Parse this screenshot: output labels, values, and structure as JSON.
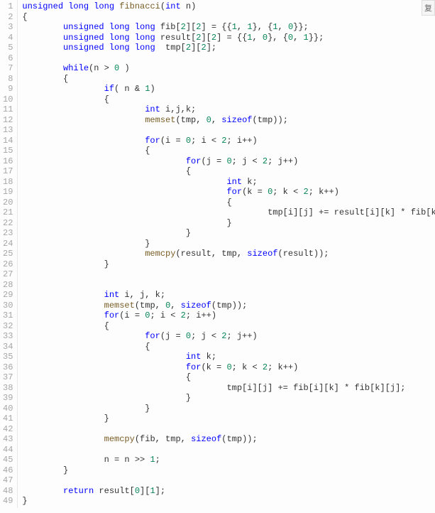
{
  "copy_label": "复",
  "lines": [
    {
      "n": 1,
      "tokens": [
        [
          "kw",
          "unsigned"
        ],
        [
          "pl",
          " "
        ],
        [
          "kw",
          "long"
        ],
        [
          "pl",
          " "
        ],
        [
          "kw",
          "long"
        ],
        [
          "pl",
          " "
        ],
        [
          "fn",
          "fibnacci"
        ],
        [
          "pl",
          "("
        ],
        [
          "kw",
          "int"
        ],
        [
          "pl",
          " n)"
        ]
      ]
    },
    {
      "n": 2,
      "tokens": [
        [
          "pl",
          "{"
        ]
      ]
    },
    {
      "n": 3,
      "tokens": [
        [
          "pl",
          "        "
        ],
        [
          "kw",
          "unsigned"
        ],
        [
          "pl",
          " "
        ],
        [
          "kw",
          "long"
        ],
        [
          "pl",
          " "
        ],
        [
          "kw",
          "long"
        ],
        [
          "pl",
          " fib["
        ],
        [
          "num",
          "2"
        ],
        [
          "pl",
          "]["
        ],
        [
          "num",
          "2"
        ],
        [
          "pl",
          "] = {{"
        ],
        [
          "num",
          "1"
        ],
        [
          "pl",
          ", "
        ],
        [
          "num",
          "1"
        ],
        [
          "pl",
          "}, {"
        ],
        [
          "num",
          "1"
        ],
        [
          "pl",
          ", "
        ],
        [
          "num",
          "0"
        ],
        [
          "pl",
          "}};"
        ]
      ]
    },
    {
      "n": 4,
      "tokens": [
        [
          "pl",
          "        "
        ],
        [
          "kw",
          "unsigned"
        ],
        [
          "pl",
          " "
        ],
        [
          "kw",
          "long"
        ],
        [
          "pl",
          " "
        ],
        [
          "kw",
          "long"
        ],
        [
          "pl",
          " result["
        ],
        [
          "num",
          "2"
        ],
        [
          "pl",
          "]["
        ],
        [
          "num",
          "2"
        ],
        [
          "pl",
          "] = {{"
        ],
        [
          "num",
          "1"
        ],
        [
          "pl",
          ", "
        ],
        [
          "num",
          "0"
        ],
        [
          "pl",
          "}, {"
        ],
        [
          "num",
          "0"
        ],
        [
          "pl",
          ", "
        ],
        [
          "num",
          "1"
        ],
        [
          "pl",
          "}};"
        ]
      ]
    },
    {
      "n": 5,
      "tokens": [
        [
          "pl",
          "        "
        ],
        [
          "kw",
          "unsigned"
        ],
        [
          "pl",
          " "
        ],
        [
          "kw",
          "long"
        ],
        [
          "pl",
          " "
        ],
        [
          "kw",
          "long"
        ],
        [
          "pl",
          "  tmp["
        ],
        [
          "num",
          "2"
        ],
        [
          "pl",
          "]["
        ],
        [
          "num",
          "2"
        ],
        [
          "pl",
          "];"
        ]
      ]
    },
    {
      "n": 6,
      "tokens": [
        [
          "pl",
          ""
        ]
      ]
    },
    {
      "n": 7,
      "tokens": [
        [
          "pl",
          "        "
        ],
        [
          "kw",
          "while"
        ],
        [
          "pl",
          "(n > "
        ],
        [
          "num",
          "0"
        ],
        [
          "pl",
          " )"
        ]
      ]
    },
    {
      "n": 8,
      "tokens": [
        [
          "pl",
          "        {"
        ]
      ]
    },
    {
      "n": 9,
      "tokens": [
        [
          "pl",
          "                "
        ],
        [
          "kw",
          "if"
        ],
        [
          "pl",
          "( n & "
        ],
        [
          "num",
          "1"
        ],
        [
          "pl",
          ")"
        ]
      ]
    },
    {
      "n": 10,
      "tokens": [
        [
          "pl",
          "                {"
        ]
      ]
    },
    {
      "n": 11,
      "tokens": [
        [
          "pl",
          "                        "
        ],
        [
          "kw",
          "int"
        ],
        [
          "pl",
          " i,j,k;"
        ]
      ]
    },
    {
      "n": 12,
      "tokens": [
        [
          "pl",
          "                        "
        ],
        [
          "fn",
          "memset"
        ],
        [
          "pl",
          "(tmp, "
        ],
        [
          "num",
          "0"
        ],
        [
          "pl",
          ", "
        ],
        [
          "kw",
          "sizeof"
        ],
        [
          "pl",
          "(tmp));"
        ]
      ]
    },
    {
      "n": 13,
      "tokens": [
        [
          "pl",
          ""
        ]
      ]
    },
    {
      "n": 14,
      "tokens": [
        [
          "pl",
          "                        "
        ],
        [
          "kw",
          "for"
        ],
        [
          "pl",
          "(i = "
        ],
        [
          "num",
          "0"
        ],
        [
          "pl",
          "; i < "
        ],
        [
          "num",
          "2"
        ],
        [
          "pl",
          "; i++)"
        ]
      ]
    },
    {
      "n": 15,
      "tokens": [
        [
          "pl",
          "                        {"
        ]
      ]
    },
    {
      "n": 16,
      "tokens": [
        [
          "pl",
          "                                "
        ],
        [
          "kw",
          "for"
        ],
        [
          "pl",
          "(j = "
        ],
        [
          "num",
          "0"
        ],
        [
          "pl",
          "; j < "
        ],
        [
          "num",
          "2"
        ],
        [
          "pl",
          "; j++)"
        ]
      ]
    },
    {
      "n": 17,
      "tokens": [
        [
          "pl",
          "                                {"
        ]
      ]
    },
    {
      "n": 18,
      "tokens": [
        [
          "pl",
          "                                        "
        ],
        [
          "kw",
          "int"
        ],
        [
          "pl",
          " k;"
        ]
      ]
    },
    {
      "n": 19,
      "tokens": [
        [
          "pl",
          "                                        "
        ],
        [
          "kw",
          "for"
        ],
        [
          "pl",
          "(k = "
        ],
        [
          "num",
          "0"
        ],
        [
          "pl",
          "; k < "
        ],
        [
          "num",
          "2"
        ],
        [
          "pl",
          "; k++)"
        ]
      ]
    },
    {
      "n": 20,
      "tokens": [
        [
          "pl",
          "                                        {"
        ]
      ]
    },
    {
      "n": 21,
      "tokens": [
        [
          "pl",
          "                                                tmp[i][j] += result[i][k] * fib[k][j];"
        ]
      ]
    },
    {
      "n": 22,
      "tokens": [
        [
          "pl",
          "                                        }"
        ]
      ]
    },
    {
      "n": 23,
      "tokens": [
        [
          "pl",
          "                                }"
        ]
      ]
    },
    {
      "n": 24,
      "tokens": [
        [
          "pl",
          "                        }"
        ]
      ]
    },
    {
      "n": 25,
      "tokens": [
        [
          "pl",
          "                        "
        ],
        [
          "fn",
          "memcpy"
        ],
        [
          "pl",
          "(result, tmp, "
        ],
        [
          "kw",
          "sizeof"
        ],
        [
          "pl",
          "(result));"
        ]
      ]
    },
    {
      "n": 26,
      "tokens": [
        [
          "pl",
          "                }"
        ]
      ]
    },
    {
      "n": 27,
      "tokens": [
        [
          "pl",
          ""
        ]
      ]
    },
    {
      "n": 28,
      "tokens": [
        [
          "pl",
          ""
        ]
      ]
    },
    {
      "n": 29,
      "tokens": [
        [
          "pl",
          "                "
        ],
        [
          "kw",
          "int"
        ],
        [
          "pl",
          " i, j, k;"
        ]
      ]
    },
    {
      "n": 30,
      "tokens": [
        [
          "pl",
          "                "
        ],
        [
          "fn",
          "memset"
        ],
        [
          "pl",
          "(tmp, "
        ],
        [
          "num",
          "0"
        ],
        [
          "pl",
          ", "
        ],
        [
          "kw",
          "sizeof"
        ],
        [
          "pl",
          "(tmp));"
        ]
      ]
    },
    {
      "n": 31,
      "tokens": [
        [
          "pl",
          "                "
        ],
        [
          "kw",
          "for"
        ],
        [
          "pl",
          "(i = "
        ],
        [
          "num",
          "0"
        ],
        [
          "pl",
          "; i < "
        ],
        [
          "num",
          "2"
        ],
        [
          "pl",
          "; i++)"
        ]
      ]
    },
    {
      "n": 32,
      "tokens": [
        [
          "pl",
          "                {"
        ]
      ]
    },
    {
      "n": 33,
      "tokens": [
        [
          "pl",
          "                        "
        ],
        [
          "kw",
          "for"
        ],
        [
          "pl",
          "(j = "
        ],
        [
          "num",
          "0"
        ],
        [
          "pl",
          "; j < "
        ],
        [
          "num",
          "2"
        ],
        [
          "pl",
          "; j++)"
        ]
      ]
    },
    {
      "n": 34,
      "tokens": [
        [
          "pl",
          "                        {"
        ]
      ]
    },
    {
      "n": 35,
      "tokens": [
        [
          "pl",
          "                                "
        ],
        [
          "kw",
          "int"
        ],
        [
          "pl",
          " k;"
        ]
      ]
    },
    {
      "n": 36,
      "tokens": [
        [
          "pl",
          "                                "
        ],
        [
          "kw",
          "for"
        ],
        [
          "pl",
          "(k = "
        ],
        [
          "num",
          "0"
        ],
        [
          "pl",
          "; k < "
        ],
        [
          "num",
          "2"
        ],
        [
          "pl",
          "; k++)"
        ]
      ]
    },
    {
      "n": 37,
      "tokens": [
        [
          "pl",
          "                                {"
        ]
      ]
    },
    {
      "n": 38,
      "tokens": [
        [
          "pl",
          "                                        tmp[i][j] += fib[i][k] * fib[k][j];"
        ]
      ]
    },
    {
      "n": 39,
      "tokens": [
        [
          "pl",
          "                                }"
        ]
      ]
    },
    {
      "n": 40,
      "tokens": [
        [
          "pl",
          "                        }"
        ]
      ]
    },
    {
      "n": 41,
      "tokens": [
        [
          "pl",
          "                }"
        ]
      ]
    },
    {
      "n": 42,
      "tokens": [
        [
          "pl",
          ""
        ]
      ]
    },
    {
      "n": 43,
      "tokens": [
        [
          "pl",
          "                "
        ],
        [
          "fn",
          "memcpy"
        ],
        [
          "pl",
          "(fib, tmp, "
        ],
        [
          "kw",
          "sizeof"
        ],
        [
          "pl",
          "(tmp));"
        ]
      ]
    },
    {
      "n": 44,
      "tokens": [
        [
          "pl",
          ""
        ]
      ]
    },
    {
      "n": 45,
      "tokens": [
        [
          "pl",
          "                n = n >> "
        ],
        [
          "num",
          "1"
        ],
        [
          "pl",
          ";"
        ]
      ]
    },
    {
      "n": 46,
      "tokens": [
        [
          "pl",
          "        }"
        ]
      ]
    },
    {
      "n": 47,
      "tokens": [
        [
          "pl",
          ""
        ]
      ]
    },
    {
      "n": 48,
      "tokens": [
        [
          "pl",
          "        "
        ],
        [
          "kw",
          "return"
        ],
        [
          "pl",
          " result["
        ],
        [
          "num",
          "0"
        ],
        [
          "pl",
          "]["
        ],
        [
          "num",
          "1"
        ],
        [
          "pl",
          "];"
        ]
      ]
    },
    {
      "n": 49,
      "tokens": [
        [
          "pl",
          "}"
        ]
      ]
    }
  ]
}
